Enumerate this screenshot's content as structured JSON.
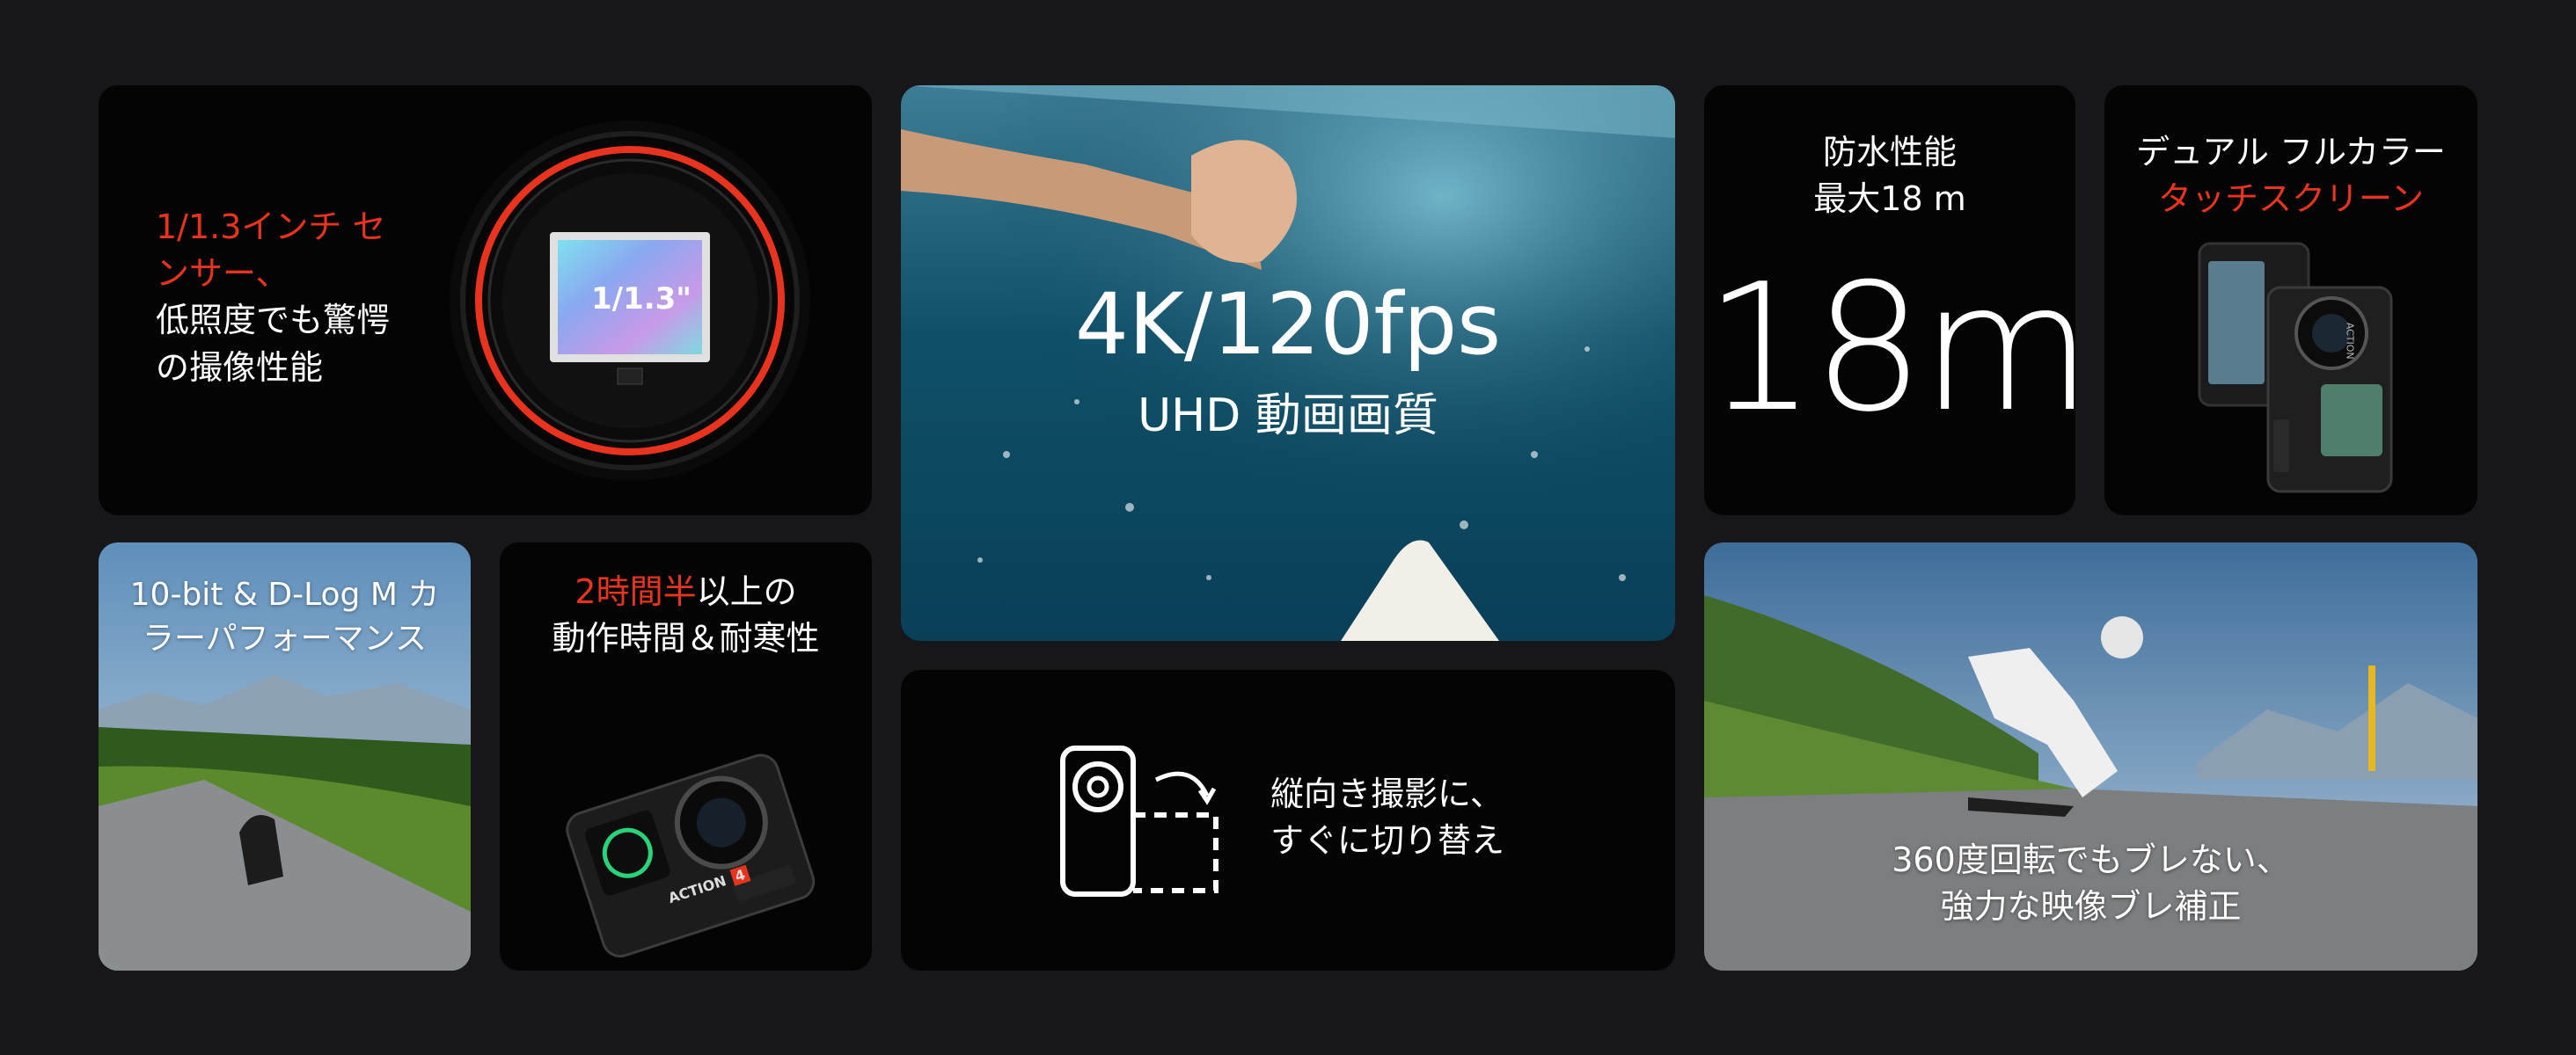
{
  "sensor": {
    "headline_line1": "1/1.3インチ セ",
    "headline_line2": "ンサー、",
    "body_line1": "低照度でも驚愕",
    "body_line2": "の撮像性能",
    "chip_label": "1/1.3\""
  },
  "video": {
    "headline": "4K/120fps",
    "subtitle": "UHD 動画画質"
  },
  "waterproof": {
    "label_line1": "防水性能",
    "label_line2": "最大18 m",
    "big_value": "18m"
  },
  "screen": {
    "line1": "デュアル フルカラー",
    "line2": "タッチスクリーン",
    "camera_brand": "ACTION"
  },
  "dlog": {
    "line1": "10-bit & D-Log M カ",
    "line2": "ラーパフォーマンス"
  },
  "battery": {
    "accent": "2時間半",
    "line1_rest": "以上の",
    "line2": "動作時間＆耐寒性",
    "camera_brand": "ACTION",
    "camera_model": "4"
  },
  "vertical": {
    "line1": "縦向き撮影に、",
    "line2": "すぐに切り替え"
  },
  "stabilization": {
    "line1": "360度回転でもブレない、",
    "line2": "強力な映像ブレ補正"
  },
  "colors": {
    "accent": "#e8341f",
    "page_background": "#17171a",
    "card_background": "#040404"
  }
}
